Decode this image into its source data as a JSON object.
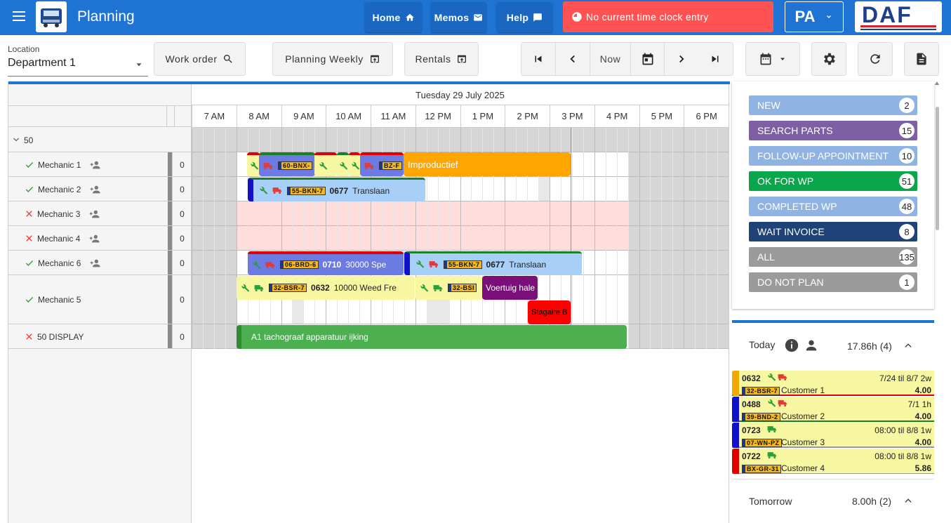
{
  "header": {
    "title": "Planning",
    "home": "Home",
    "memos": "Memos",
    "help": "Help",
    "clock_alert": "No current time clock entry",
    "user": "PA",
    "brand": "DAF"
  },
  "toolbar": {
    "location_label": "Location",
    "location_value": "Department 1",
    "work_order": "Work order",
    "planning_weekly": "Planning Weekly",
    "rentals": "Rentals",
    "now": "Now"
  },
  "grid": {
    "date": "Tuesday 29 July 2025",
    "hours": [
      "7 AM",
      "8 AM",
      "9 AM",
      "10 AM",
      "11 AM",
      "12 PM",
      "1 PM",
      "2 PM",
      "3 PM",
      "4 PM",
      "5 PM",
      "6 PM"
    ],
    "group": "50"
  },
  "mechanics": [
    {
      "name": "Mechanic 1",
      "count": "0",
      "ok": true
    },
    {
      "name": "Mechanic 2",
      "count": "0",
      "ok": true
    },
    {
      "name": "Mechanic 3",
      "count": "0",
      "ok": false
    },
    {
      "name": "Mechanic 4",
      "count": "0",
      "ok": false
    },
    {
      "name": "Mechanic 6",
      "count": "0",
      "ok": true
    },
    {
      "name": "Mechanic 5",
      "count": "0",
      "ok": true
    },
    {
      "name": "50 DISPLAY",
      "count": "0",
      "ok": false
    }
  ],
  "events": {
    "e1_plate": "60-BNX-",
    "e2_plate": "BZ-F",
    "e3_text": "Improductief",
    "e4_plate": "55-BKN-7",
    "e4_num": "0677",
    "e4_text": "Translaan",
    "e5_plate": "06-BRD-6",
    "e5_num": "0710",
    "e5_text": "30000  Spe",
    "e6_plate": "55-BKN-7",
    "e6_num": "0677",
    "e6_text": "Translaan",
    "e7_plate": "32-BSR-7",
    "e7_num": "0632",
    "e7_text": "10000  Weed Fre",
    "e8_plate": "32-BSI",
    "e9_text": "Voertuig hale",
    "e10_text": "Stagaire B",
    "e11_text": "A1 tachograaf apparatuur ijking"
  },
  "statuses": [
    {
      "label": "NEW",
      "count": "2",
      "color": "#8fb4e3"
    },
    {
      "label": "SEARCH PARTS",
      "count": "15",
      "color": "#7e5fa3"
    },
    {
      "label": "FOLLOW-UP APPOINTMENT",
      "count": "10",
      "color": "#8fb4e3"
    },
    {
      "label": "OK FOR WP",
      "count": "51",
      "color": "#0aa64b"
    },
    {
      "label": "COMPLETED WP",
      "count": "48",
      "color": "#8fb4e3"
    },
    {
      "label": "WAIT INVOICE",
      "count": "8",
      "color": "#1f4378"
    },
    {
      "label": "ALL",
      "count": "135",
      "color": "#9b9b9b"
    },
    {
      "label": "DO NOT PLAN",
      "count": "1",
      "color": "#9b9b9b"
    }
  ],
  "today": {
    "label": "Today",
    "hours": "17.86h (4)"
  },
  "cards": [
    {
      "num": "0632",
      "range": "7/24 til 8/7 2w",
      "plate": "32-BSR-7",
      "customer": "Customer 1",
      "hours": "4.00",
      "color": "#f2a900"
    },
    {
      "num": "0488",
      "range": "7/1 1h",
      "plate": "39-BND-2",
      "customer": "Customer 2",
      "hours": "4.00",
      "color": "#1111cc"
    },
    {
      "num": "0723",
      "range": "08:00 til 8/8 1w",
      "plate": "07-WN-PZ",
      "customer": "Customer 3",
      "hours": "4.00",
      "color": "#1111cc"
    },
    {
      "num": "0722",
      "range": "08:00 til 8/8 1w",
      "plate": "BX-GR-31",
      "customer": "Customer 4",
      "hours": "5.86",
      "color": "#e00000"
    }
  ],
  "tomorrow": {
    "label": "Tomorrow",
    "hours": "8.00h (2)"
  }
}
